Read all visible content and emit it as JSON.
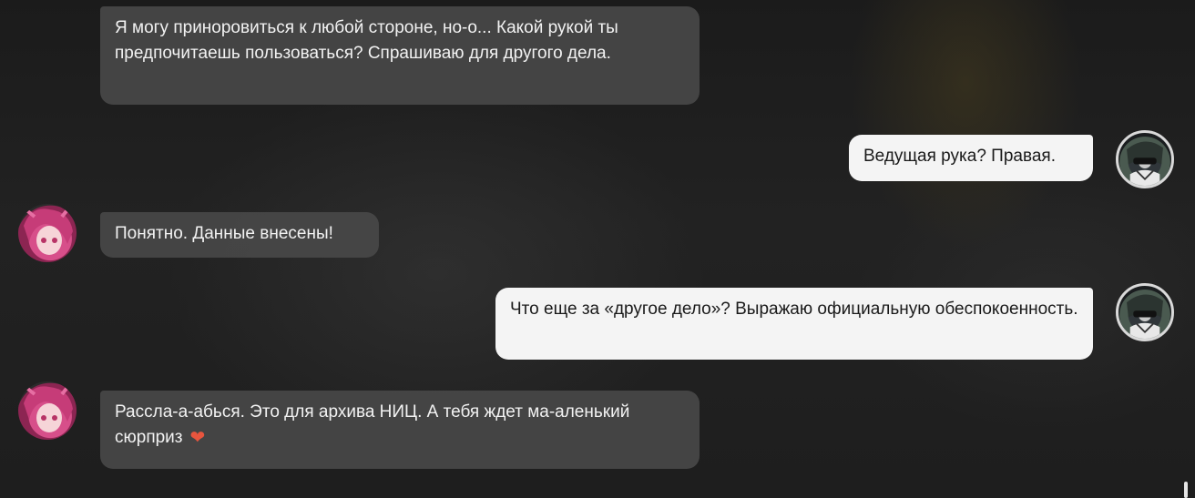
{
  "messages": [
    {
      "sender": "npc",
      "text": "Я могу приноровиться к любой стороне, но-о... Какой рукой ты предпочитаешь пользоваться? Спрашиваю для другого дела."
    },
    {
      "sender": "user",
      "text": "Ведущая рука? Правая."
    },
    {
      "sender": "npc",
      "text": "Понятно. Данные внесены!"
    },
    {
      "sender": "user",
      "text": "Что еще за «другое дело»? Выражаю официальную обеспокоенность."
    },
    {
      "sender": "npc",
      "text": "Рассла-а-абься. Это для архива НИЦ. А тебя ждет ма-аленький сюрприз",
      "icon": "heart-icon"
    }
  ],
  "icons": {
    "heart": "❤"
  },
  "colors": {
    "npc_bubble": "#484848",
    "user_bubble": "#f4f4f4",
    "background": "#1e1e1e",
    "heart": "#e8553e"
  }
}
